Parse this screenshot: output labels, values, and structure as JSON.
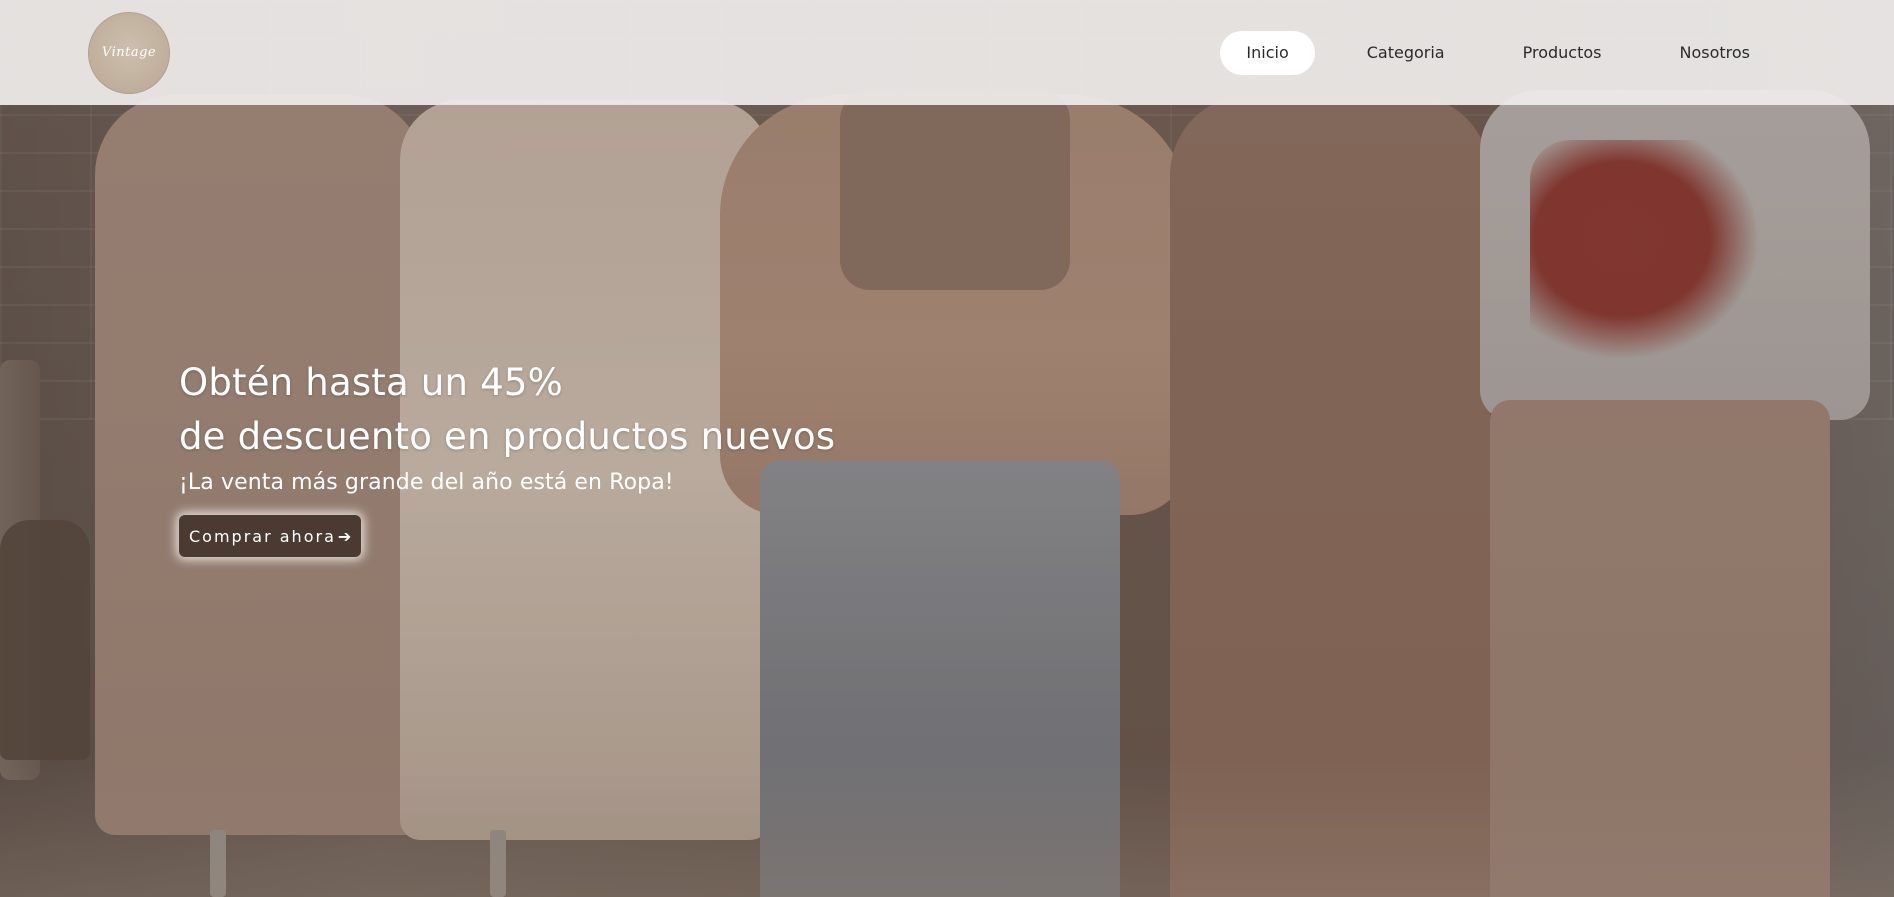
{
  "header": {
    "logo_text": "Vintage",
    "nav": [
      {
        "label": "Inicio",
        "active": true
      },
      {
        "label": "Categoria",
        "active": false
      },
      {
        "label": "Productos",
        "active": false
      },
      {
        "label": "Nosotros",
        "active": false
      }
    ]
  },
  "hero": {
    "headline_line1": "Obtén hasta un 45%",
    "headline_line2": "de descuento en productos nuevos",
    "subline": "¡La venta más grande del año está en Ropa!",
    "cta_label": "Comprar ahora",
    "cta_icon": "arrow-right-icon"
  },
  "colors": {
    "header_bg": "#eeeceb",
    "active_pill": "#ffffff",
    "cta_bg": "#4a3a32",
    "text_light": "#ffffff",
    "nav_text": "#2b2b2b"
  }
}
